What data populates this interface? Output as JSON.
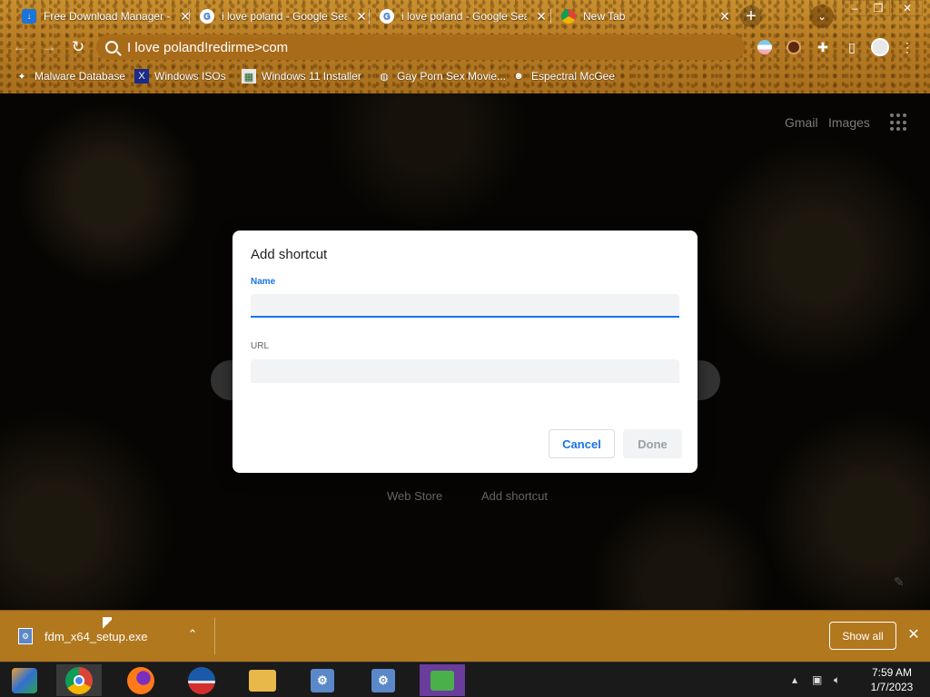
{
  "tabs": [
    {
      "title": "Free Download Manager -",
      "favicon": "fdm-icon",
      "active": false
    },
    {
      "title": "i love poland - Google Sear",
      "favicon": "google-icon",
      "active": false
    },
    {
      "title": "i love poland - Google Sear",
      "favicon": "google-icon",
      "active": false
    },
    {
      "title": "New Tab",
      "favicon": "chrome-icon",
      "active": true
    }
  ],
  "toolbar": {
    "omnibox_text": "I love poland!redirme>com"
  },
  "bookmarks": [
    {
      "label": "Malware Database",
      "icon": "bookmark-icon"
    },
    {
      "label": "Windows ISOs",
      "icon": "x-icon"
    },
    {
      "label": "Windows 11 Installer",
      "icon": "image-icon"
    },
    {
      "label": "Gay Porn Sex Movie...",
      "icon": "globe-icon"
    },
    {
      "label": "Espectral McGee",
      "icon": "avatar-icon"
    }
  ],
  "ntp": {
    "gmail_link": "Gmail",
    "images_link": "Images",
    "shortcuts": [
      {
        "label": "Web Store"
      },
      {
        "label": "Add shortcut"
      }
    ]
  },
  "dialog": {
    "title": "Add shortcut",
    "name_label": "Name",
    "name_value": "",
    "url_label": "URL",
    "url_value": "",
    "cancel_label": "Cancel",
    "done_label": "Done"
  },
  "download_shelf": {
    "filename": "fdm_x64_setup.exe",
    "show_all_label": "Show all"
  },
  "taskbar": {
    "time": "7:59 AM",
    "date": "1/7/2023"
  },
  "colors": {
    "accent": "#1a73e8",
    "theme": "#b97e24"
  }
}
